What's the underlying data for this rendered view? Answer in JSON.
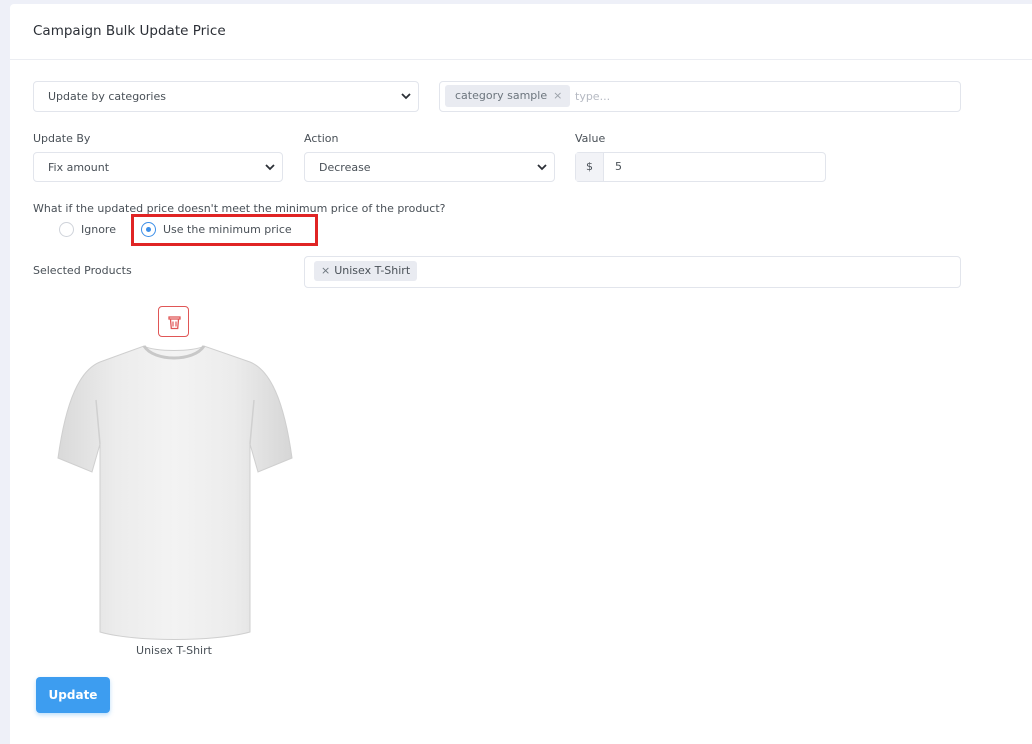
{
  "page": {
    "title": "Campaign Bulk Update Price"
  },
  "filter": {
    "mode_selected": "Update by categories",
    "tags": [
      {
        "label": "category sample",
        "remove": "×"
      }
    ],
    "placeholder": "type..."
  },
  "update_by": {
    "label": "Update By",
    "selected": "Fix amount"
  },
  "action": {
    "label": "Action",
    "selected": "Decrease"
  },
  "value": {
    "label": "Value",
    "prefix": "$",
    "value": "5"
  },
  "min_price": {
    "question": "What if the updated price doesn't meet the minimum price of the product?",
    "options": [
      {
        "label": "Ignore",
        "checked": false
      },
      {
        "label": "Use the minimum price",
        "checked": true
      }
    ]
  },
  "selected_products": {
    "label": "Selected Products",
    "tags": [
      {
        "label": "Unisex T-Shirt",
        "remove": "×"
      }
    ],
    "items": [
      {
        "name": "Unisex T-Shirt"
      }
    ]
  },
  "buttons": {
    "update": "Update"
  },
  "colors": {
    "primary": "#3d9df0",
    "radio_active": "#3c8fe8",
    "highlight": "#e02424",
    "danger": "#e05656"
  }
}
